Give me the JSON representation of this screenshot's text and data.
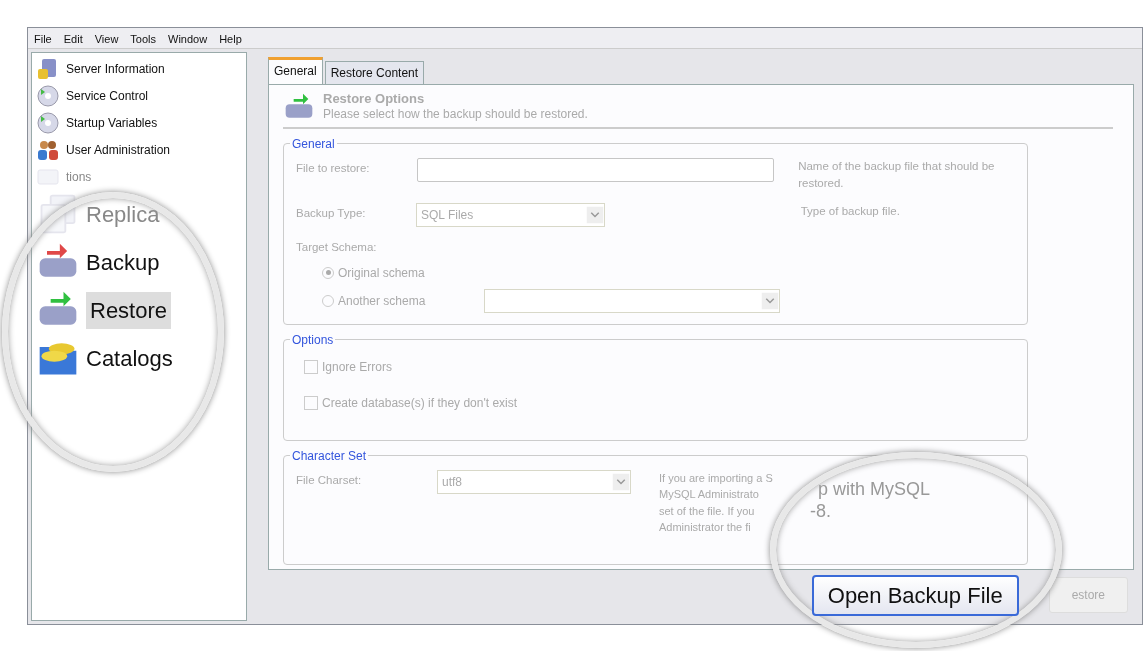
{
  "menu": [
    "File",
    "Edit",
    "View",
    "Tools",
    "Window",
    "Help"
  ],
  "sidebar": {
    "items": [
      {
        "label": "Server Information",
        "kind": "normal",
        "selected": false
      },
      {
        "label": "Service Control",
        "kind": "normal",
        "selected": false
      },
      {
        "label": "Startup Variables",
        "kind": "normal",
        "selected": false
      },
      {
        "label": "User Administration",
        "kind": "normal",
        "selected": false
      },
      {
        "label": "tions",
        "kind": "faded",
        "selected": false
      },
      {
        "label": "Replica",
        "kind": "faded-large",
        "selected": false
      },
      {
        "label": "Backup",
        "kind": "large",
        "selected": false
      },
      {
        "label": "Restore",
        "kind": "large",
        "selected": true
      },
      {
        "label": "Catalogs",
        "kind": "large",
        "selected": false
      }
    ]
  },
  "tabs": [
    {
      "label": "General",
      "selected": true
    },
    {
      "label": "Restore Content",
      "selected": false
    }
  ],
  "header": {
    "title": "Restore Options",
    "subtitle": "Please select how the backup should be restored."
  },
  "disabled": true,
  "general": {
    "legend": "General",
    "file_label": "File to restore:",
    "file_help": "Name of the backup file that should be restored.",
    "type_label": "Backup Type:",
    "type_value": "SQL Files",
    "type_help": "Type of backup file.",
    "schema_label": "Target Schema:",
    "radios": [
      {
        "label": "Original schema",
        "selected": true
      },
      {
        "label": "Another schema",
        "selected": false
      }
    ]
  },
  "options": {
    "legend": "Options",
    "checks": [
      {
        "label": "Ignore Errors",
        "checked": false
      },
      {
        "label": "Create database(s) if they don't exist",
        "checked": false
      }
    ]
  },
  "charset": {
    "legend": "Character Set",
    "label": "File Charset:",
    "value": "utf8",
    "help": [
      "If you are importing a S",
      "MySQL Administrato",
      "set of the file. If you",
      "Administrator the fi"
    ],
    "magnified": [
      "p with MySQL",
      "-8."
    ]
  },
  "buttons": [
    {
      "label": "Open Backup File",
      "kind": "magnified"
    },
    {
      "label": "estore",
      "kind": "disabled"
    }
  ]
}
